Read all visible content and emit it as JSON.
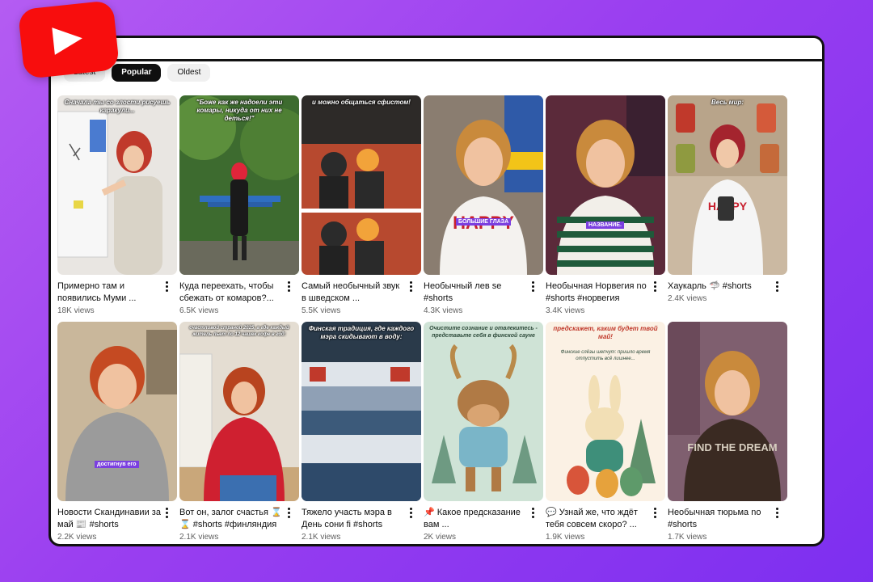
{
  "filters": [
    "Latest",
    "Popular",
    "Oldest"
  ],
  "active_filter": "Popular",
  "videos": [
    {
      "title": "Примерно там и появились Муми ...",
      "views": "18K views",
      "overlay": "Сначала ты со злости рисуешь каракули..."
    },
    {
      "title": "Куда переехать, чтобы сбежать от комаров?...",
      "views": "6.5K views",
      "overlay": "\"Боже как же надоели эти комары, никуда от них не деться!\""
    },
    {
      "title": "Самый необычный звук в шведском ...",
      "views": "5.5K views",
      "overlay": "и можно общаться сфистом!"
    },
    {
      "title": "Необычный лев se #shorts",
      "views": "4.3K views",
      "overlay": "",
      "tag": "БОЛЬШИЕ ГЛАЗА"
    },
    {
      "title": "Необычная Норвегия no #shorts #норвегия",
      "views": "3.4K views",
      "overlay": "",
      "tag": "НАЗВАНИЕ."
    },
    {
      "title": "Хаукарль 🦈 #shorts",
      "views": "2.4K views",
      "overlay": "Весь мир:"
    },
    {
      "title": "Новости Скандинавии за май 📰 #shorts",
      "views": "2.2K views",
      "overlay": "",
      "tag": "достигнув его"
    },
    {
      "title": "Вот он, залог счастья ⌛ ⌛ #shorts #финляндия",
      "views": "2.1K views",
      "overlay": "счастливой страной 2025, а где каждый житель пьет по 12 чашек кофе в год:"
    },
    {
      "title": "Тяжело участь мэра в День сони fi #shorts",
      "views": "2.1K views",
      "overlay": "Финская традиция, где каждого мэра скидывают в воду:"
    },
    {
      "title": "📌 Какое предсказание вам ...",
      "views": "2K views",
      "overlay": "Очистите сознание и отвлекитесь - представьте себя в финской сауне"
    },
    {
      "title": "💬 Узнай же, что ждёт тебя совсем скоро? ...",
      "views": "1.9K views",
      "overlay": "предскажет, каким будет твой май!",
      "overlay2": "Финские слёзы шепчут: пришло время отпустить всё лишнее..."
    },
    {
      "title": "Необычная тюрьма no #shorts",
      "views": "1.7K views",
      "overlay": ""
    }
  ],
  "colors": {
    "accent": "#f80d0d",
    "background": "#9a3ff0",
    "tag": "#7b3fe0"
  },
  "icons": {
    "logo": "youtube-logo-icon",
    "menu": "more-vert-icon"
  }
}
